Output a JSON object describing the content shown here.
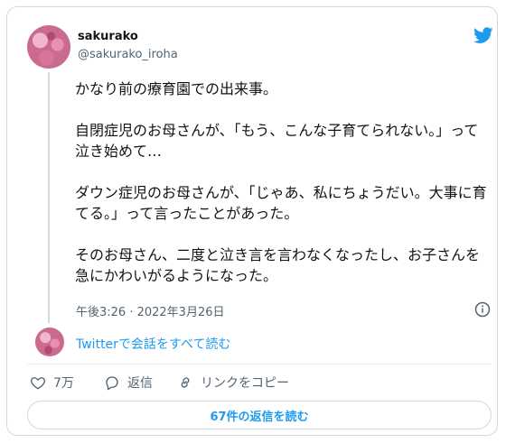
{
  "user": {
    "name": "sakurako",
    "handle": "@sakurako_iroha"
  },
  "tweet": {
    "paragraphs": [
      "かなり前の療育園での出来事。",
      "自閉症児のお母さんが、「もう、こんな子育てられない。」って泣き始めて…",
      "ダウン症児のお母さんが、「じゃあ、私にちょうだい。大事に育てる。」って言ったことがあった。",
      "そのお母さん、二度と泣き言を言わなくなったし、お子さんを急にかわいがるようになった。"
    ],
    "timestamp": "午後3:26 · 2022年3月26日"
  },
  "thread_link": "Twitterで会話をすべて読む",
  "actions": {
    "likes": "7万",
    "reply": "返信",
    "copy_link": "リンクをコピー"
  },
  "read_replies": "67件の返信を読む",
  "colors": {
    "accent": "#1d9bf0",
    "muted": "#536471",
    "text": "#0f1419",
    "border": "#cfd9de"
  },
  "icons": [
    "twitter-bird-icon",
    "info-icon",
    "heart-icon",
    "reply-bubble-icon",
    "link-icon"
  ]
}
